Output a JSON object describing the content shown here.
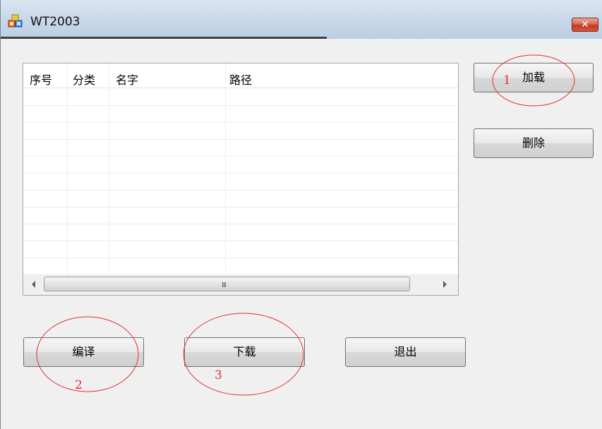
{
  "window": {
    "title": "WT2003",
    "close_glyph": "✕"
  },
  "list": {
    "columns": [
      "序号",
      "分类",
      "名字",
      "路径"
    ],
    "scroll_grip": "III"
  },
  "buttons": {
    "load": "加载",
    "delete": "删除",
    "compile": "编译",
    "download": "下载",
    "exit": "退出"
  },
  "annotations": {
    "marker_1": "1",
    "marker_2": "2",
    "marker_3": "3",
    "color": "#e23030"
  }
}
